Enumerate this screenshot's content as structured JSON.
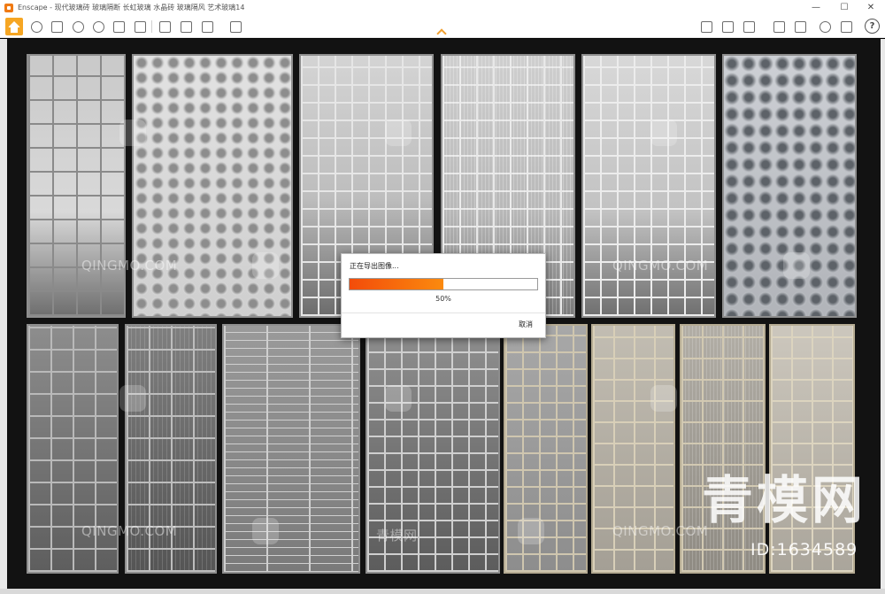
{
  "window": {
    "title": "Enscape - 现代玻璃砖 玻璃隔断 长虹玻璃 水晶砖 玻璃隔风 艺术玻璃14",
    "controls": [
      "—",
      "☐",
      "✕"
    ]
  },
  "toolbar": {
    "help_label": "?"
  },
  "export_dialog": {
    "title": "正在导出图像...",
    "progress": 0.5,
    "progress_label": "50%",
    "cancel_label": "取消",
    "accent_color": "#f7670d"
  },
  "watermark": {
    "site_text": "QINGMO.COM",
    "site_text_cn": "青模网",
    "big_text": "青模网",
    "id_text": "ID:1634589"
  }
}
